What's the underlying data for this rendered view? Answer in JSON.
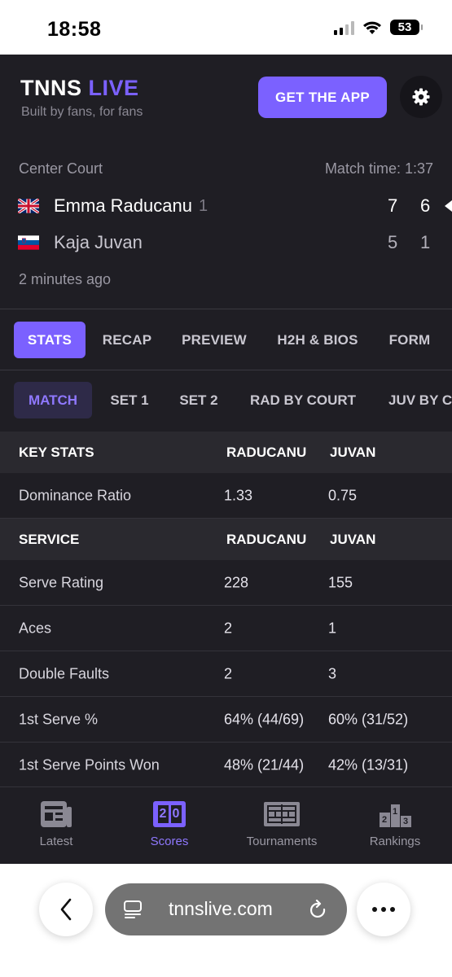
{
  "status_bar": {
    "time": "18:58",
    "battery": "53"
  },
  "header": {
    "logo_main": "TNNS",
    "logo_accent": "LIVE",
    "tagline": "Built by fans, for fans",
    "get_app_label": "GET THE APP"
  },
  "match": {
    "court": "Center Court",
    "match_time": "Match time: 1:37",
    "ago": "2 minutes ago",
    "players": [
      {
        "name": "Emma Raducanu",
        "seed": "1",
        "flag": "gb",
        "scores": [
          "7",
          "6"
        ]
      },
      {
        "name": "Kaja Juvan",
        "seed": "",
        "flag": "si",
        "scores": [
          "5",
          "1"
        ]
      }
    ]
  },
  "tabs": [
    "STATS",
    "RECAP",
    "PREVIEW",
    "H2H & BIOS",
    "FORM"
  ],
  "active_tab": "STATS",
  "subtabs": [
    "MATCH",
    "SET 1",
    "SET 2",
    "RAD BY COURT",
    "JUV BY C"
  ],
  "active_subtab": "MATCH",
  "stats": {
    "key_header": [
      "KEY STATS",
      "RADUCANU",
      "JUVAN"
    ],
    "key_rows": [
      [
        "Dominance Ratio",
        "1.33",
        "0.75"
      ]
    ],
    "service_header": [
      "SERVICE",
      "RADUCANU",
      "JUVAN"
    ],
    "service_rows": [
      [
        "Serve Rating",
        "228",
        "155"
      ],
      [
        "Aces",
        "2",
        "1"
      ],
      [
        "Double Faults",
        "2",
        "3"
      ],
      [
        "1st Serve %",
        "64% (44/69)",
        "60% (31/52)"
      ],
      [
        "1st Serve Points Won",
        "48% (21/44)",
        "42% (13/31)"
      ]
    ]
  },
  "bottom_nav": [
    {
      "label": "Latest",
      "icon": "news-icon"
    },
    {
      "label": "Scores",
      "icon": "scoreboard-icon",
      "badge_left": "2",
      "badge_right": "0"
    },
    {
      "label": "Tournaments",
      "icon": "court-icon"
    },
    {
      "label": "Rankings",
      "icon": "podium-icon",
      "podium": [
        "2",
        "1",
        "3"
      ]
    }
  ],
  "active_nav": "Scores",
  "browser": {
    "url": "tnnslive.com"
  },
  "colors": {
    "accent": "#7b61ff",
    "background": "#1f1e24"
  }
}
